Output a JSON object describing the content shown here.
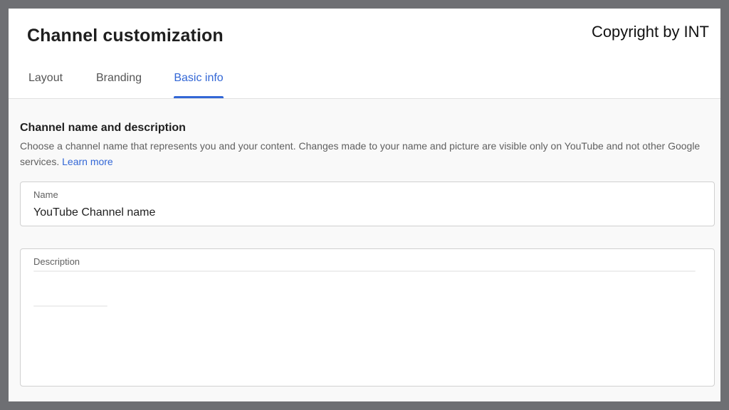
{
  "page": {
    "title": "Channel customization",
    "copyright": "Copyright by INT"
  },
  "tabs": [
    {
      "label": "Layout",
      "active": false
    },
    {
      "label": "Branding",
      "active": false
    },
    {
      "label": "Basic info",
      "active": true
    }
  ],
  "section": {
    "title": "Channel name and description",
    "description": "Choose a channel name that represents you and your content. Changes made to your name and picture are visible only on YouTube and not other Google services.",
    "learn_more": "Learn more"
  },
  "fields": {
    "name": {
      "label": "Name",
      "value": "YouTube Channel name"
    },
    "description": {
      "label": "Description"
    }
  },
  "colors": {
    "accent": "#3367d6",
    "frame_background": "#6e6f73"
  }
}
